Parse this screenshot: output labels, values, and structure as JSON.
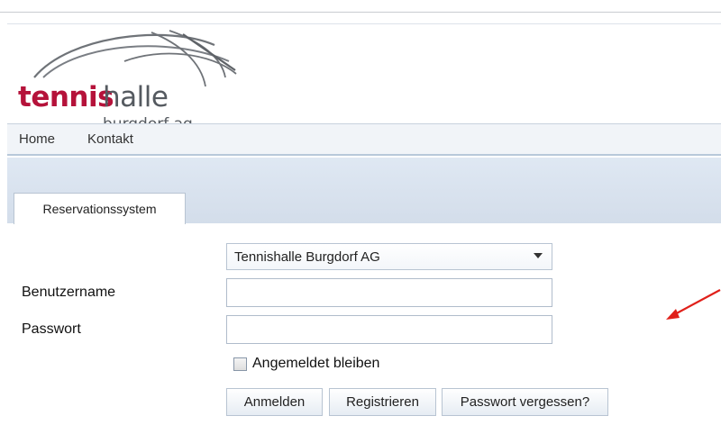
{
  "logo": {
    "word_tennis": "tennis",
    "word_halle": "halle",
    "subtitle": "burgdorf ag"
  },
  "nav": {
    "items": [
      {
        "label": "Home"
      },
      {
        "label": "Kontakt"
      }
    ]
  },
  "tabs": [
    {
      "label": "Reservationssystem",
      "active": true
    }
  ],
  "form": {
    "location_select": {
      "value": "Tennishalle Burgdorf AG",
      "options_visible": [
        "Tennishalle Burgdorf AG"
      ]
    },
    "username": {
      "label": "Benutzername",
      "value": ""
    },
    "password": {
      "label": "Passwort",
      "value": ""
    },
    "remember": {
      "label": "Angemeldet bleiben",
      "checked": false
    },
    "buttons": {
      "login": "Anmelden",
      "register": "Registrieren",
      "forgot": "Passwort vergessen?"
    }
  },
  "colors": {
    "brand_red": "#b5123a",
    "brand_gray": "#555a60",
    "nav_bg": "#f1f4f8",
    "band_bg": "#dbe4ef",
    "annotation_arrow": "#e0201a"
  },
  "icons": {
    "dropdown": "chevron-down-icon",
    "annotation": "red-arrow-icon"
  }
}
